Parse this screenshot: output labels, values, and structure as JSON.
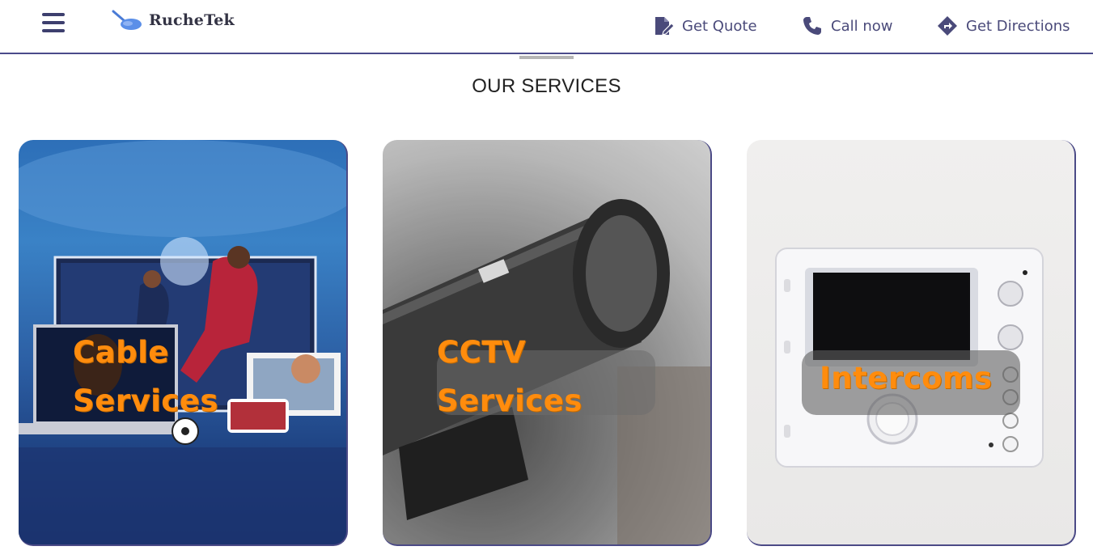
{
  "header": {
    "brand_name": "RucheTek",
    "menu_icon": "hamburger-menu-icon",
    "actions": [
      {
        "label": "Get Quote",
        "icon": "quote-document-icon"
      },
      {
        "label": "Call now",
        "icon": "phone-icon"
      },
      {
        "label": "Get Directions",
        "icon": "directions-icon"
      }
    ]
  },
  "services": {
    "title": "OUR SERVICES",
    "cards": [
      {
        "label_line1": "Cable",
        "label_line2": "Services"
      },
      {
        "label_line1": "CCTV",
        "label_line2": "Services"
      },
      {
        "label_line1": "Intercoms",
        "label_line2": ""
      }
    ]
  },
  "colors": {
    "accent": "#4a4a8a",
    "label": "#ff8c0d",
    "nav_text": "#4a4a7a"
  }
}
